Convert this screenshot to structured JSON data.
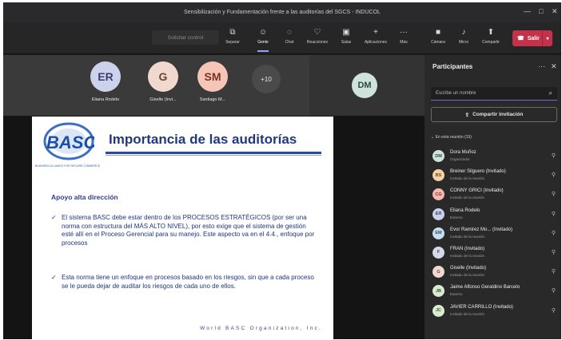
{
  "window": {
    "title": "Sensibilización y Fundamentación frente a las auditorías del SGCS - INDUCOL",
    "controls": [
      "—",
      "□",
      "✕"
    ]
  },
  "toolbar": {
    "search_placeholder": "Solicitar control",
    "buttons": [
      {
        "icon": "share-screen-icon",
        "glyph": "⧉",
        "label": "Separar"
      },
      {
        "icon": "people-icon",
        "glyph": "☺",
        "label": "Gente",
        "active": true
      },
      {
        "icon": "chat-icon",
        "glyph": "◌",
        "label": "Chat"
      },
      {
        "icon": "reactions-icon",
        "glyph": "♡",
        "label": "Reacciones"
      },
      {
        "icon": "rooms-icon",
        "glyph": "▣",
        "label": "Salas"
      },
      {
        "icon": "apps-icon",
        "glyph": "+",
        "label": "Aplicaciones"
      },
      {
        "icon": "more-icon",
        "glyph": "···",
        "label": "Más"
      },
      {
        "icon": "camera-icon",
        "glyph": "■",
        "label": "Cámara"
      },
      {
        "icon": "mic-icon",
        "glyph": "♪",
        "label": "Micro"
      },
      {
        "icon": "share-icon",
        "glyph": "⬆",
        "label": "Compartir"
      }
    ],
    "leave_label": "Salir"
  },
  "stage": {
    "tiles": [
      {
        "initials": "ER",
        "name": "Eliana Rodelo",
        "bg": "#cdd2ec",
        "fg": "#3a3f6a"
      },
      {
        "initials": "G",
        "name": "Giselle (Invi...",
        "bg": "#f1d9cf",
        "fg": "#6b4637"
      },
      {
        "initials": "SM",
        "name": "Santiago M...",
        "bg": "#f5c6b8",
        "fg": "#7a3222"
      }
    ],
    "more_count": "+10",
    "spotlight_initials": "DM"
  },
  "slide": {
    "logo_text": "BASC",
    "logo_sub": "BUSINESS ALLIANCE FOR SECURE COMMERCE",
    "title": "Importancia de las auditorías",
    "subtitle": "Apoyo alta dirección",
    "bullets": [
      "El sistema BASC debe estar dentro de los PROCESOS ESTRATÉGICOS (por ser una norma con estructura del MÁS ALTO NIVEL), por esto exige que el sistema de gestión esté allí en el Proceso Gerencial para su manejo. Este aspecto va en el 4.4., enfoque por procesos",
      "Esta norma tiene un enfoque en procesos basado en los riesgos, sin que a cada proceso se le pueda dejar de auditar los riesgos de cada uno de ellos."
    ],
    "footer": "World BASC Organization, Inc."
  },
  "sidebar": {
    "title": "Participantes",
    "search_placeholder": "Escribe un nombre",
    "share_label": "Compartir invitación",
    "section_label": "En esta reunión (15)",
    "participants": [
      {
        "initials": "DM",
        "name": "Dora Muñoz",
        "role": "Organizador",
        "bg": "#cde3dc",
        "fg": "#2c4a3f"
      },
      {
        "initials": "BS",
        "name": "Breiner Silguero (Invitado)",
        "role": "Invitado de la reunión",
        "bg": "#f5d3a8",
        "fg": "#6b4a1c"
      },
      {
        "initials": "CG",
        "name": "CONNY GRICI (Invitado)",
        "role": "Invitado de la reunión",
        "bg": "#f3b9b0",
        "fg": "#7a2e24"
      },
      {
        "initials": "ER",
        "name": "Eliana Rodelo",
        "role": "Externo",
        "bg": "#cdd2ec",
        "fg": "#3a3f6a"
      },
      {
        "initials": "EM",
        "name": "Evor Ramirez Mo... (Invitado)",
        "role": "Invitado de la reunión",
        "bg": "#c9dff0",
        "fg": "#24506e"
      },
      {
        "initials": "F",
        "name": "FRAN (Invitado)",
        "role": "Invitado de la reunión",
        "bg": "#d6d9e8",
        "fg": "#3a3f5a"
      },
      {
        "initials": "G",
        "name": "Giselle (Invitado)",
        "role": "Invitado de la reunión",
        "bg": "#f1d9cf",
        "fg": "#6b4637"
      },
      {
        "initials": "JB",
        "name": "Jaime Alfonso Geraldino Barcelo",
        "role": "Externo",
        "bg": "#d9ecd0",
        "fg": "#36572a"
      },
      {
        "initials": "JC",
        "name": "JAVIER CARRILLO (Invitado)",
        "role": "Invitado de la reunión",
        "bg": "#d9ecd0",
        "fg": "#36572a"
      }
    ]
  }
}
